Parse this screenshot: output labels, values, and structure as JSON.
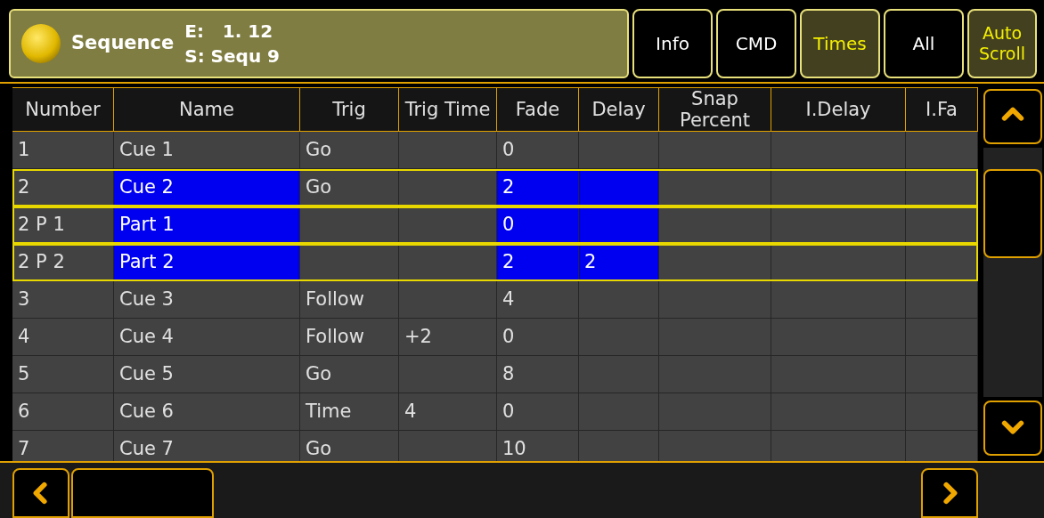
{
  "header": {
    "title": "Sequence",
    "line_1": "E:   1. 12",
    "line_2": "S: Sequ 9"
  },
  "buttons": [
    {
      "label": "Info",
      "selected": false
    },
    {
      "label": "CMD",
      "selected": false
    },
    {
      "label": "Times",
      "selected": true
    },
    {
      "label": "All",
      "selected": false
    },
    {
      "label": "Auto Scroll",
      "selected": true
    }
  ],
  "table": {
    "columns": [
      {
        "label": "Number",
        "highlighted": false
      },
      {
        "label": "Name",
        "highlighted": true
      },
      {
        "label": "Trig",
        "highlighted": false
      },
      {
        "label": "Trig Time",
        "highlighted": false
      },
      {
        "label": "Fade",
        "highlighted": true
      },
      {
        "label": "Delay",
        "highlighted": true
      },
      {
        "label": "Snap Percent",
        "highlighted": false
      },
      {
        "label": "I.Delay",
        "highlighted": false
      },
      {
        "label": "I.Fa",
        "highlighted": false
      }
    ],
    "rows": [
      {
        "selected": false,
        "cells": [
          "1",
          "Cue 1",
          "Go",
          null,
          "0",
          null,
          null,
          null,
          null
        ]
      },
      {
        "selected": true,
        "cells": [
          "2",
          "Cue 2",
          "Go",
          null,
          "2",
          null,
          null,
          null,
          null
        ]
      },
      {
        "selected": true,
        "cells": [
          "2 P 1",
          "Part 1",
          null,
          null,
          "0",
          null,
          null,
          null,
          null
        ]
      },
      {
        "selected": true,
        "cells": [
          "2 P 2",
          "Part 2",
          null,
          null,
          "2",
          "2",
          null,
          null,
          null
        ]
      },
      {
        "selected": false,
        "cells": [
          "3",
          "Cue 3",
          "Follow",
          null,
          "4",
          null,
          null,
          null,
          null
        ]
      },
      {
        "selected": false,
        "cells": [
          "4",
          "Cue 4",
          "Follow",
          "+2",
          "0",
          null,
          null,
          null,
          null
        ]
      },
      {
        "selected": false,
        "cells": [
          "5",
          "Cue 5",
          "Go",
          null,
          "8",
          null,
          null,
          null,
          null
        ]
      },
      {
        "selected": false,
        "cells": [
          "6",
          "Cue 6",
          "Time",
          "4",
          "0",
          null,
          null,
          null,
          null
        ]
      },
      {
        "selected": false,
        "cells": [
          "7",
          "Cue 7",
          "Go",
          null,
          "10",
          null,
          null,
          null,
          null
        ]
      }
    ]
  }
}
